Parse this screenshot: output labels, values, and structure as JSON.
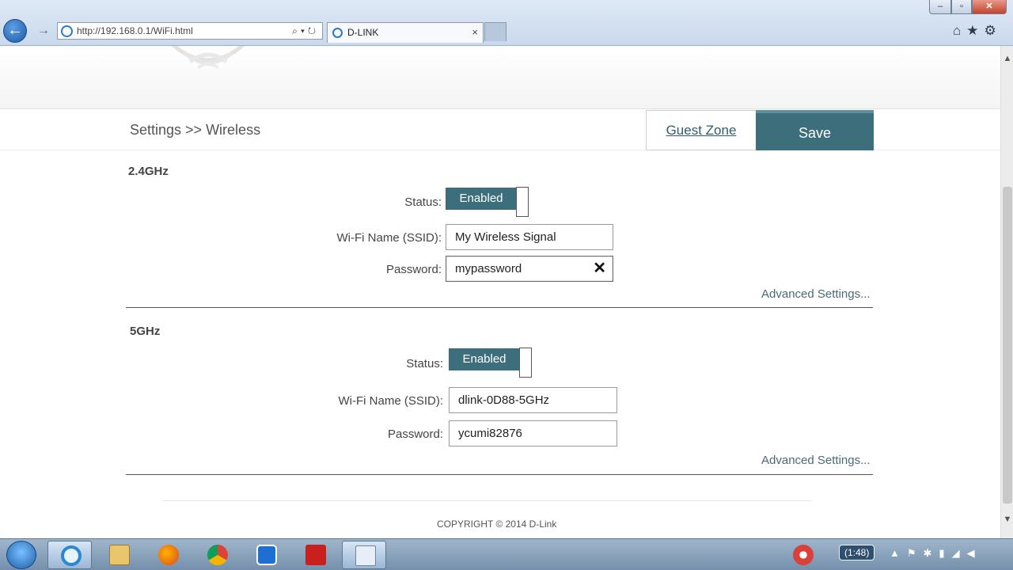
{
  "browser": {
    "url": "http://192.168.0.1/WiFi.html",
    "tab_title": "D-LINK",
    "tab_close": "×",
    "window_min": "–",
    "window_max": "▫",
    "window_close": "✕",
    "back_glyph": "←",
    "forward_glyph": "→",
    "address_icons": "⌕▾↻",
    "tool_icons": "⌂★⚙",
    "icons": [
      "ie-icon",
      "search-icon",
      "refresh-icon",
      "home-icon",
      "favorites-star-icon",
      "gear-icon"
    ]
  },
  "header": {
    "breadcrumb": "Settings >> Wireless",
    "guest_zone_label": "Guest Zone",
    "save_label": "Save",
    "logo_icon": "wifi-signal-icon"
  },
  "band_24": {
    "title": "2.4GHz",
    "status_label": "Status:",
    "status_value": "Enabled",
    "ssid_label": "Wi-Fi Name (SSID):",
    "ssid_value": "My Wireless Signal",
    "password_label": "Password:",
    "password_value": "mypassword",
    "clear_glyph": "✕",
    "advanced_link": "Advanced Settings..."
  },
  "band_5": {
    "title": "5GHz",
    "status_label": "Status:",
    "status_value": "Enabled",
    "ssid_label": "Wi-Fi Name (SSID):",
    "ssid_value": "dlink-0D88-5GHz",
    "password_label": "Password:",
    "password_value": "ycumi82876",
    "advanced_link": "Advanced Settings..."
  },
  "footer": {
    "copyright": "COPYRIGHT © 2014 D-Link"
  },
  "taskbar": {
    "clock_badge": "(1:48)",
    "tray_glyphs": "▲⚑✱▮◢◀",
    "apps": [
      "internet-explorer-icon",
      "file-explorer-icon",
      "firefox-icon",
      "chrome-icon",
      "teamviewer-icon",
      "filezilla-icon",
      "notepad-icon",
      "recorder-icon"
    ]
  },
  "colors": {
    "accent": "#3d6e7b",
    "link": "#4a6a76"
  }
}
